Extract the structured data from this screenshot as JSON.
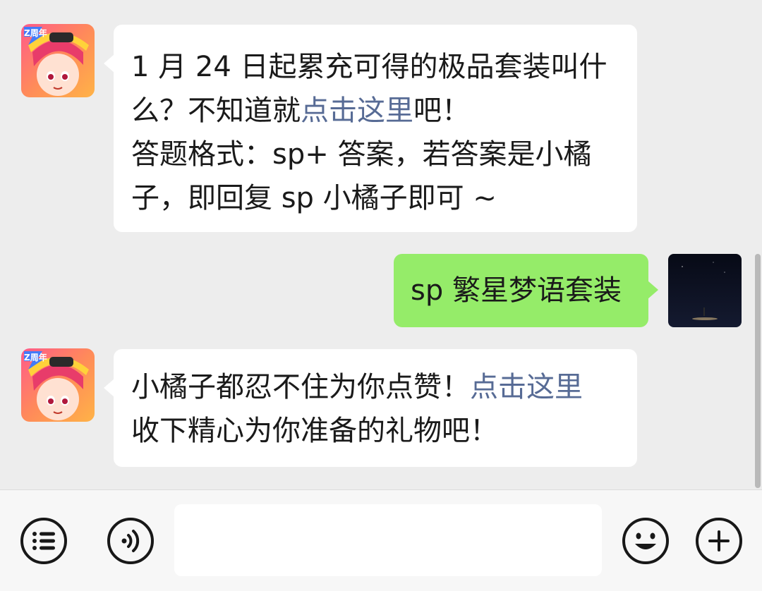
{
  "messages": [
    {
      "side": "in",
      "lines": [
        {
          "a": "1 月 24 日起累充可得的极品套装叫什"
        },
        {
          "a": "么？不知道就",
          "link": "点击这里",
          "b": "吧！"
        },
        {
          "a": "答题格式：sp+ 答案，若答案是小橘"
        },
        {
          "a": "子，即回复 sp 小橘子即可 ~"
        }
      ]
    },
    {
      "side": "out",
      "text": "sp 繁星梦语套装"
    },
    {
      "side": "in",
      "lines": [
        {
          "a": "小橘子都忍不住为你点赞！",
          "link": "点击这里"
        },
        {
          "a": "收下精心为你准备的礼物吧！"
        }
      ]
    }
  ],
  "avatar_badge_text": "Z周年",
  "input": {
    "value": "",
    "placeholder": ""
  },
  "icons": {
    "menu": "list-menu-icon",
    "voice": "voice-icon",
    "emoji": "emoji-icon",
    "more": "plus-icon"
  },
  "colors": {
    "chat_bg": "#ededed",
    "incoming_bubble": "#ffffff",
    "outgoing_bubble": "#95ec69",
    "link": "#576b95",
    "input_bar": "#f7f7f7"
  }
}
